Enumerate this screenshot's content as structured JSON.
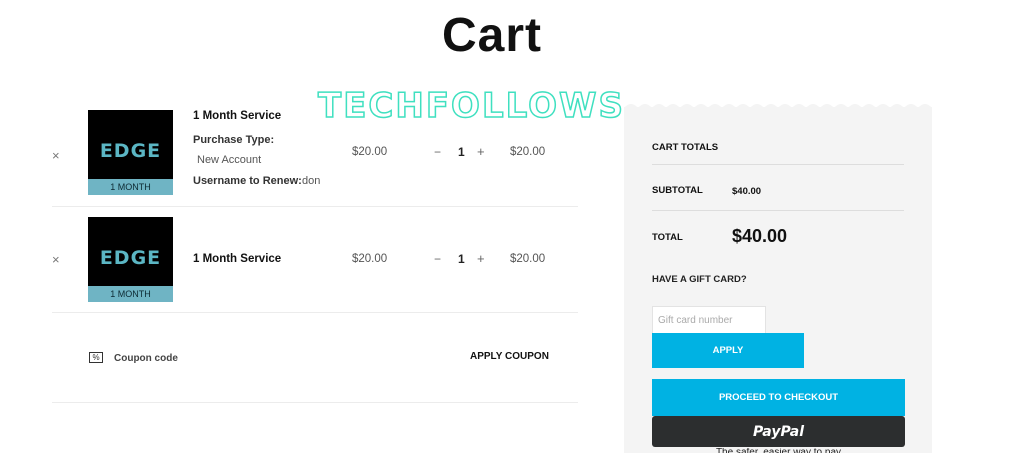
{
  "page": {
    "title": "Cart"
  },
  "watermark": {
    "text": "TECHFOLLOWS"
  },
  "cart_items": [
    {
      "remove_glyph": "×",
      "thumbnail": {
        "logo_text": "EDGE",
        "band_text": "1 MONTH"
      },
      "name": "1 Month Service",
      "meta": [
        {
          "label": "Purchase Type:",
          "value": "New Account"
        },
        {
          "label": "Username to Renew:",
          "value": "don"
        }
      ],
      "price": "$20.00",
      "quantity": "1",
      "minus": "−",
      "plus": "+",
      "subtotal": "$20.00"
    },
    {
      "remove_glyph": "×",
      "thumbnail": {
        "logo_text": "EDGE",
        "band_text": "1 MONTH"
      },
      "name": "1 Month Service",
      "price": "$20.00",
      "quantity": "1",
      "minus": "−",
      "plus": "+",
      "subtotal": "$20.00"
    }
  ],
  "coupon": {
    "icon": "coupon-percent-icon",
    "icon_glyph": "%",
    "placeholder": "Coupon code",
    "apply_label": "APPLY COUPON"
  },
  "totals": {
    "heading": "CART TOTALS",
    "subtotal_label": "SUBTOTAL",
    "subtotal_value": "$40.00",
    "total_label": "TOTAL",
    "total_value": "$40.00",
    "gift_heading": "HAVE A GIFT CARD?",
    "gift_placeholder": "Gift card number",
    "apply_label": "APPLY",
    "checkout_label": "PROCEED TO CHECKOUT",
    "paypal_label": "PayPal",
    "paypal_tagline": "The safer, easier way to pay"
  },
  "colors": {
    "accent": "#00b2e3",
    "panel_bg": "#f4f4f4",
    "paypal_bg": "#2c2e2f",
    "thumb_band": "#6fb4c4",
    "watermark_stroke": "#3fe0c0"
  }
}
